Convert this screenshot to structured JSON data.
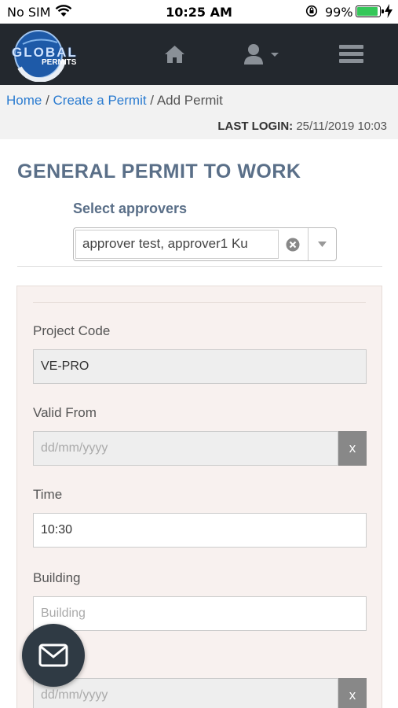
{
  "status_bar": {
    "carrier": "No SIM",
    "time": "10:25 AM",
    "battery_percent": "99%",
    "battery_level": 0.99
  },
  "navbar": {
    "logo_text_top": "GLOBAL",
    "logo_text_bottom": "PERMITS",
    "icons": [
      "home-icon",
      "user-icon",
      "hamburger-menu-icon"
    ]
  },
  "breadcrumb": {
    "home": "Home",
    "sep1": " / ",
    "create": "Create a Permit",
    "sep2": " / ",
    "current": "Add Permit"
  },
  "last_login": {
    "label": "LAST LOGIN:",
    "value": "25/11/2019 10:03"
  },
  "page_title": "GENERAL PERMIT TO WORK",
  "approvers": {
    "label": "Select approvers",
    "value": "approver test, approver1 Ku"
  },
  "form": {
    "project_code": {
      "label": "Project Code",
      "value": "VE-PRO"
    },
    "valid_from": {
      "label": "Valid From",
      "placeholder": "dd/mm/yyyy",
      "clear": "x"
    },
    "time": {
      "label": "Time",
      "value": "10:30"
    },
    "building": {
      "label": "Building",
      "placeholder": "Building"
    },
    "next_date": {
      "placeholder": "dd/mm/yyyy",
      "clear": "x"
    }
  },
  "colors": {
    "navbar": "#23282e",
    "link": "#2a7bd0",
    "title": "#5a6f88",
    "panel": "#f8f1ef",
    "fab": "#2f3a44"
  }
}
